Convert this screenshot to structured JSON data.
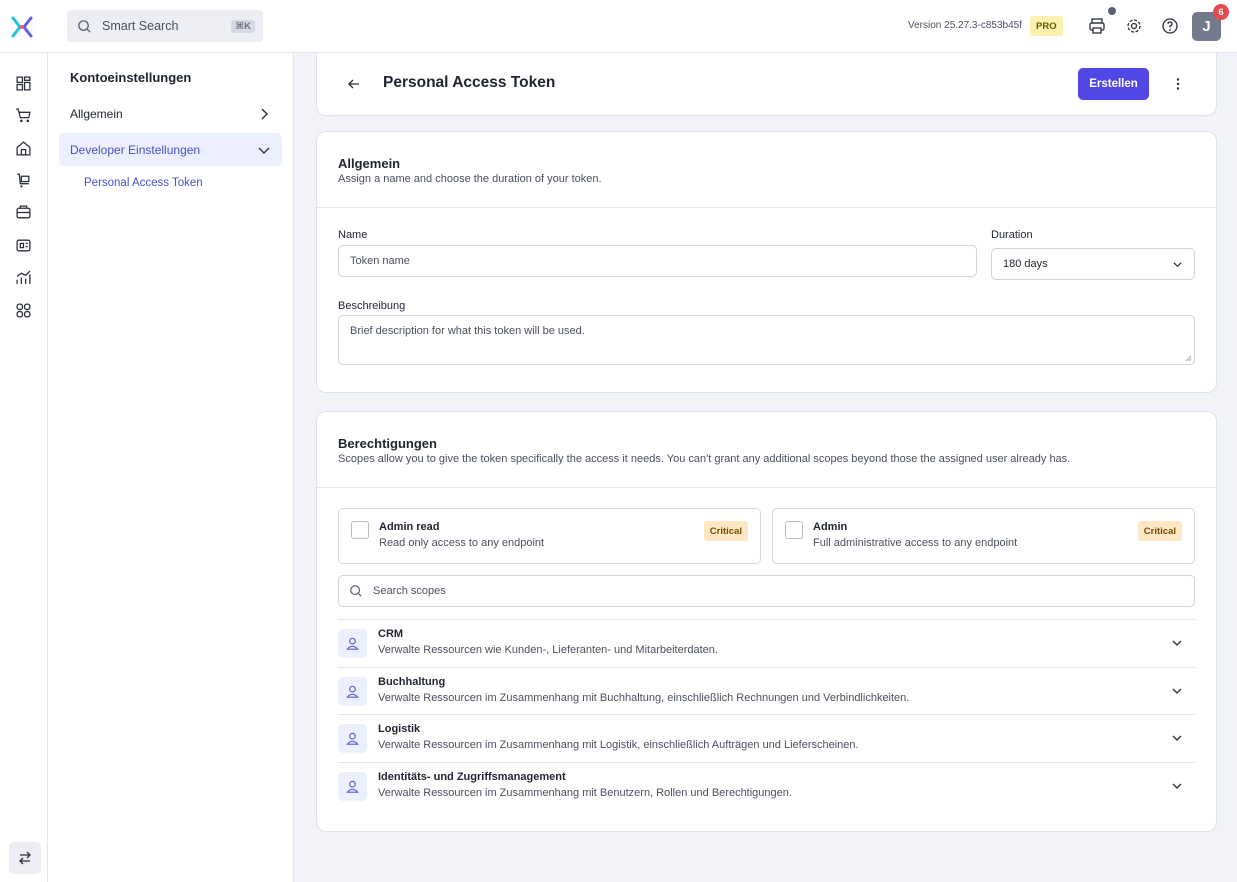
{
  "topbar": {
    "search_label": "Smart Search",
    "search_shortcut": "⌘K",
    "version": "Version 25.27.3-c853b45f",
    "plan_badge": "PRO",
    "avatar_initial": "J",
    "notification_count": "6",
    "brand_color": "#5047e5"
  },
  "rail": {
    "icons": [
      "dashboard-icon",
      "cart-icon",
      "store-icon",
      "shopping-cart-icon",
      "inventory-icon",
      "media-icon",
      "analytics-icon",
      "apps-icon"
    ],
    "bottom_icon": "switch-icon"
  },
  "sidebar": {
    "title": "Kontoeinstellungen",
    "items": [
      {
        "label": "Allgemein"
      },
      {
        "label": "Developer Einstellungen"
      }
    ],
    "sub_item": "Personal Access Token"
  },
  "header": {
    "title": "Personal Access Token",
    "create_label": "Erstellen"
  },
  "general": {
    "title": "Allgemein",
    "subtitle": "Assign a name and choose the duration of your token.",
    "name_label": "Name",
    "name_placeholder": "Token name",
    "duration_label": "Duration",
    "duration_value": "180 days",
    "description_label": "Beschreibung",
    "description_placeholder": "Brief description for what this token will be used."
  },
  "permissions": {
    "title": "Berechtigungen",
    "subtitle": "Scopes allow you to give the token specifically the access it needs. You can't grant any additional scopes beyond those the assigned user already has.",
    "special_scopes": [
      {
        "name": "Admin read",
        "description": "Read only access to any endpoint",
        "badge": "Critical"
      },
      {
        "name": "Admin",
        "description": "Full administrative access to any endpoint",
        "badge": "Critical"
      }
    ],
    "search_placeholder": "Search scopes",
    "groups": [
      {
        "name": "CRM",
        "description": "Verwalte Ressourcen wie Kunden-, Lieferanten- und Mitarbeiterdaten."
      },
      {
        "name": "Buchhaltung",
        "description": "Verwalte Ressourcen im Zusammenhang mit Buchhaltung, einschließlich Rechnungen und Verbindlichkeiten."
      },
      {
        "name": "Logistik",
        "description": "Verwalte Ressourcen im Zusammenhang mit Logistik, einschließlich Aufträgen und Lieferscheinen."
      },
      {
        "name": "Identitäts- und Zugriffsmanagement",
        "description": "Verwalte Ressourcen im Zusammenhang mit Benutzern, Rollen und Berechtigungen."
      }
    ]
  }
}
